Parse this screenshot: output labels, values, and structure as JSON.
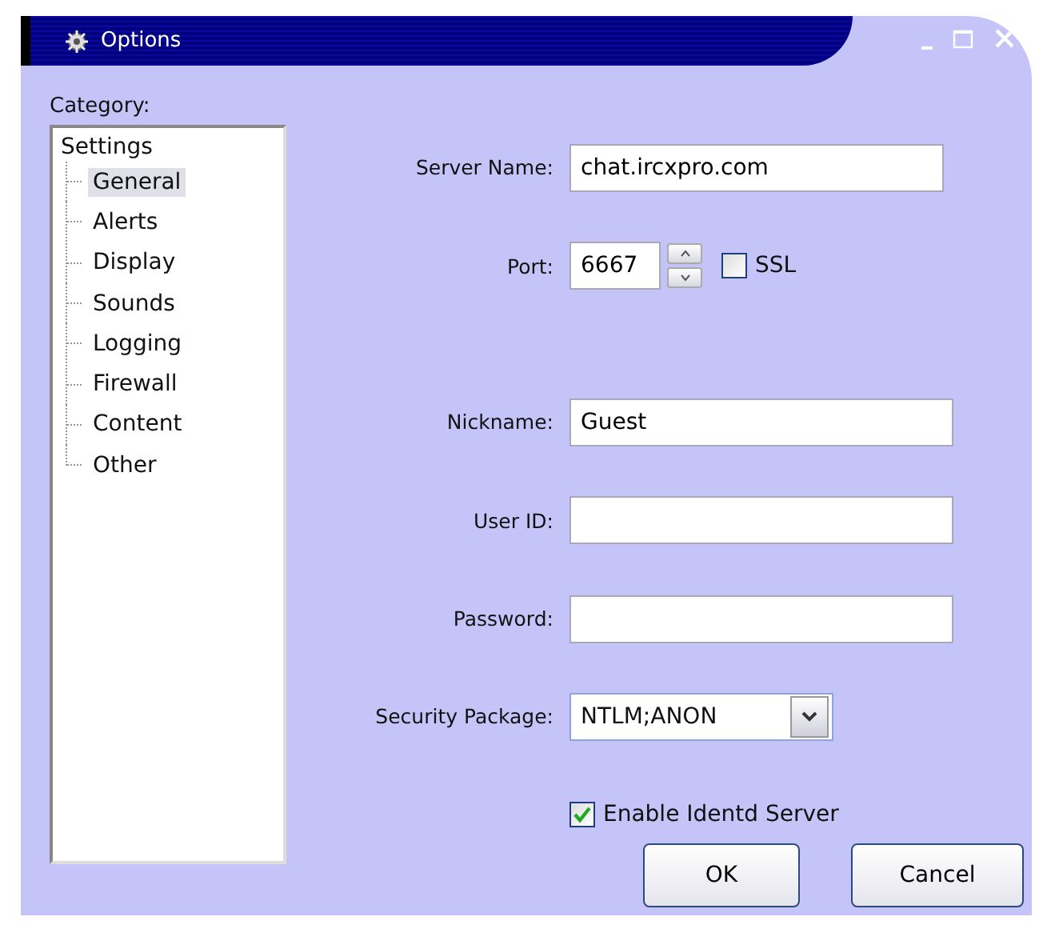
{
  "window": {
    "title": "Options"
  },
  "category_label": "Category:",
  "tree": {
    "label": "Settings",
    "children": [
      {
        "label": "General",
        "selected": true
      },
      {
        "label": "Alerts",
        "selected": false
      },
      {
        "label": "Display",
        "selected": false
      },
      {
        "label": "Sounds",
        "selected": false
      },
      {
        "label": "Logging",
        "selected": false
      },
      {
        "label": "Firewall",
        "selected": false
      },
      {
        "label": "Content",
        "selected": false
      },
      {
        "label": "Other",
        "selected": false
      }
    ]
  },
  "server_name": {
    "label": "Server Name:",
    "value": "chat.ircxpro.com"
  },
  "port": {
    "label": "Port:",
    "value": "6667"
  },
  "ssl": {
    "label": "SSL",
    "checked": false
  },
  "nickname": {
    "label": "Nickname:",
    "value": "Guest"
  },
  "user_id": {
    "label": "User ID:"
  },
  "password": {
    "label": "Password:"
  },
  "security_package": {
    "label": "Security Package:",
    "value": "NTLM;ANON"
  },
  "identd": {
    "label": "Enable Identd Server",
    "checked": true
  },
  "buttons": [
    "OK",
    "Cancel"
  ]
}
